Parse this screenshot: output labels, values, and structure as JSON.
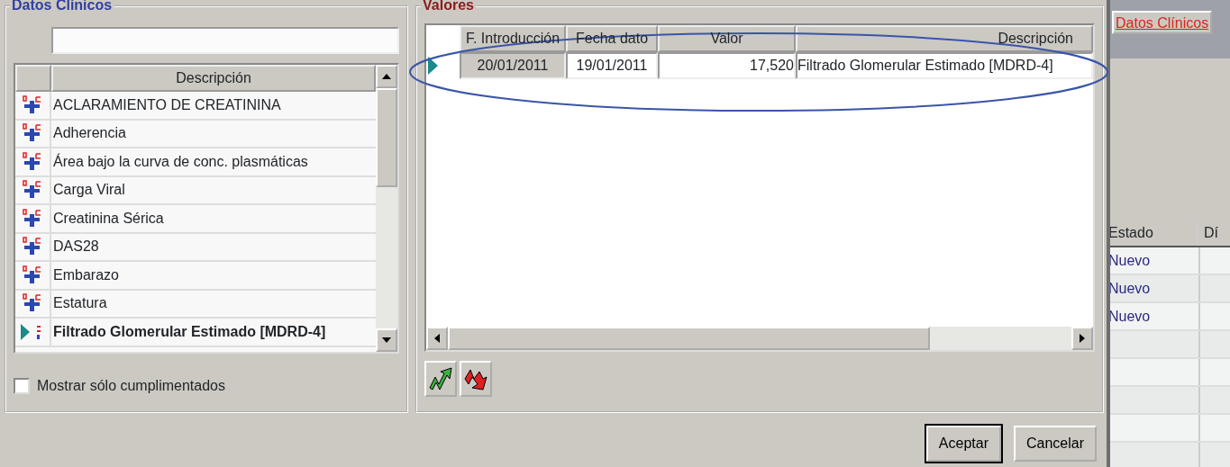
{
  "clinical_data": {
    "title": "Datos Clínicos",
    "list": {
      "column": "Descripción",
      "rows": [
        {
          "text": "ACLARAMIENTO DE CREATININA",
          "selected": false
        },
        {
          "text": "Adherencia",
          "selected": false
        },
        {
          "text": "Área bajo la curva de conc. plasmáticas",
          "selected": false
        },
        {
          "text": "Carga Viral",
          "selected": false
        },
        {
          "text": "Creatinina Sérica",
          "selected": false
        },
        {
          "text": "DAS28",
          "selected": false
        },
        {
          "text": "Embarazo",
          "selected": false
        },
        {
          "text": "Estatura",
          "selected": false
        },
        {
          "text": "Filtrado Glomerular Estimado [MDRD-4]",
          "selected": true
        }
      ]
    },
    "filter": {
      "label": "Mostrar sólo cumplimentados",
      "checked": false
    }
  },
  "values": {
    "title": "Valores",
    "columns": [
      "F. Introducción",
      "Fecha dato",
      "Valor",
      "Descripción"
    ],
    "rows": [
      {
        "cells": [
          "20/01/2011",
          "19/01/2011",
          "17,520",
          "Filtrado Glomerular Estimado [MDRD-4]"
        ],
        "selected": true
      }
    ],
    "highlighted": true
  },
  "buttons": [
    {
      "label": "Aceptar",
      "default": true
    },
    {
      "label": "Cancelar",
      "default": false
    }
  ],
  "background_window": {
    "tab": "Datos Clínicos",
    "columns": [
      "Estado",
      "Dí"
    ],
    "rows": [
      {
        "cells": [
          "Nuevo",
          ""
        ]
      },
      {
        "cells": [
          "Nuevo",
          ""
        ]
      },
      {
        "cells": [
          "Nuevo",
          ""
        ]
      }
    ]
  }
}
